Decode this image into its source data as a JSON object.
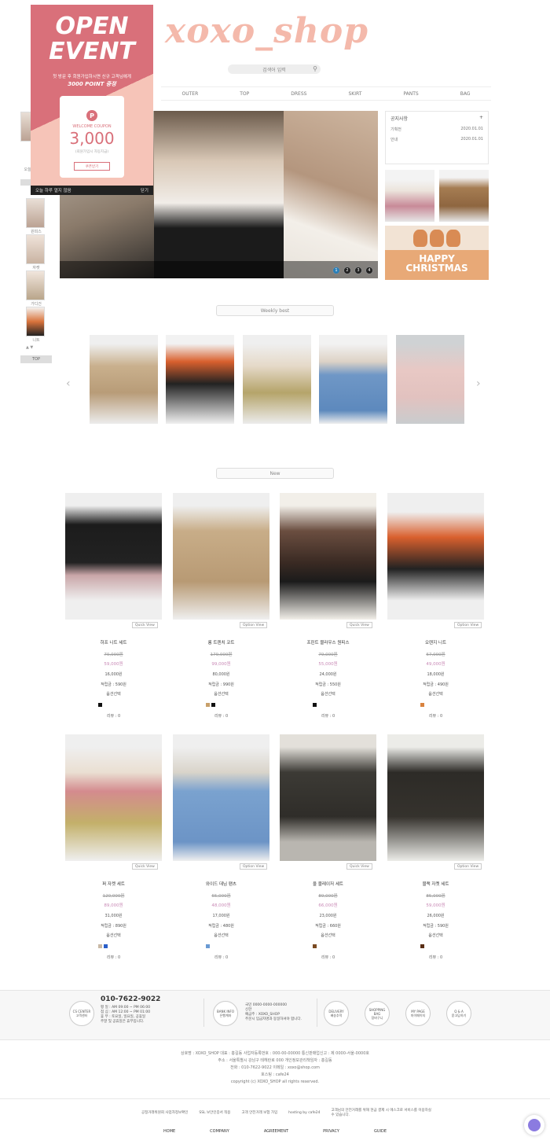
{
  "header": {
    "logo": "xoxo_shop",
    "search_placeholder": "검색어 입력",
    "nav": [
      "OUTER",
      "TOP",
      "DRESS",
      "SKIRT",
      "PANTS",
      "BAG"
    ]
  },
  "popup": {
    "title_line1": "OPEN",
    "title_line2": "EVENT",
    "subtitle": "첫 방문 후 회원가입하시면 신규 고객님에게",
    "subtitle_strong": "3000 POINT 증정",
    "coupon_label": "WELCOME COUPON",
    "coupon_amount": "3,000",
    "coupon_note": "(회원가입시 자동지급)",
    "coupon_button": "쿠폰받기",
    "close_today": "오늘 하루 열지 않음",
    "close": "닫기"
  },
  "sidebar": {
    "title": "오늘본상품",
    "labels": [
      "오늘본상품",
      "원피스",
      "자켓",
      "가디건",
      "니트"
    ],
    "button": "TOP"
  },
  "notice": {
    "title": "공지사항",
    "more": "+",
    "rows": [
      {
        "label": "기획전",
        "date": "2020.01.01"
      },
      {
        "label": "안내",
        "date": "2020.01.01"
      }
    ]
  },
  "banner": {
    "xmas_line1": "HAPPY",
    "xmas_line2": "CHRISTMAS",
    "dots": [
      "1",
      "2",
      "3",
      "4"
    ]
  },
  "sections": {
    "weekly": "Weekly best",
    "new": "New"
  },
  "products": [
    {
      "name": "하프 니트 세트",
      "old": "70,000원",
      "sale": "59,000원",
      "rate": "16,000원",
      "point": "적립금 : 590원",
      "opt": "옵션선택",
      "review": "리뷰 : 0",
      "quick": "Quick View",
      "colors": [
        "#111111"
      ]
    },
    {
      "name": "롱 트렌치 코트",
      "old": "179,000원",
      "sale": "99,000원",
      "rate": "80,000원",
      "point": "적립금 : 990원",
      "opt": "옵션선택",
      "review": "리뷰 : 0",
      "quick": "Option View",
      "colors": [
        "#c8a06a",
        "#111111"
      ]
    },
    {
      "name": "프린트 블라우스 원피스",
      "old": "79,000원",
      "sale": "55,000원",
      "rate": "24,000원",
      "point": "적립금 : 550원",
      "opt": "옵션선택",
      "review": "리뷰 : 0",
      "quick": "Quick View",
      "colors": [
        "#111111"
      ]
    },
    {
      "name": "오렌지 니트",
      "old": "67,000원",
      "sale": "49,000원",
      "rate": "18,000원",
      "point": "적립금 : 490원",
      "opt": "옵션선택",
      "review": "리뷰 : 0",
      "quick": "Option View",
      "colors": [
        "#d9833f"
      ]
    },
    {
      "name": "퍼 자켓 세트",
      "old": "120,000원",
      "sale": "89,000원",
      "rate": "31,000원",
      "point": "적립금 : 890원",
      "opt": "옵션선택",
      "review": "리뷰 : 0",
      "quick": "Quick View",
      "colors": [
        "#c9b9a5",
        "#2b5fc9"
      ]
    },
    {
      "name": "와이드 데님 팬츠",
      "old": "65,000원",
      "sale": "48,000원",
      "rate": "17,000원",
      "point": "적립금 : 480원",
      "opt": "옵션선택",
      "review": "리뷰 : 0",
      "quick": "Option View",
      "colors": [
        "#6a9ad3"
      ]
    },
    {
      "name": "울 블레이저 세트",
      "old": "89,000원",
      "sale": "66,000원",
      "rate": "23,000원",
      "point": "적립금 : 660원",
      "opt": "옵션선택",
      "review": "리뷰 : 0",
      "quick": "Quick View",
      "colors": [
        "#7a4a22"
      ]
    },
    {
      "name": "블랙 자켓 세트",
      "old": "85,000원",
      "sale": "59,000원",
      "rate": "26,000원",
      "point": "적립금 : 590원",
      "opt": "옵션선택",
      "review": "리뷰 : 0",
      "quick": "Option View",
      "colors": [
        "#5a2e16"
      ]
    }
  ],
  "footer": {
    "cs_label": "CS CENTER",
    "cs_sub": "고객센터",
    "phone": "010-7622-9022",
    "hours": [
      "평 일 : AM 09:00 ~ PM 06:00",
      "점 심 : AM 12:00 ~ PM 01:00",
      "휴 무 : 토요일, 일요일, 공휴일"
    ],
    "hours_note": "주말 및 공휴일은 휴무입니다.",
    "bank_label": "BANK INFO",
    "bank_sub": "은행계좌",
    "bank_lines": [
      "국민 0000-0000-000000",
      "신한",
      "예금주 : XOXO_SHOP",
      "주문시 입금자명과 동일하셔야 합니다."
    ],
    "circles": [
      {
        "en": "DELIVERY",
        "ko": "배송추적"
      },
      {
        "en": "SHOPPING BAG",
        "ko": "장바구니"
      },
      {
        "en": "MY PAGE",
        "ko": "마이페이지"
      },
      {
        "en": "Q & A",
        "ko": "묻고답하기"
      }
    ],
    "info_lines": [
      "상호명 : XOXO_SHOP  대표 : 홍길동  사업자등록번호 : 000-00-00000  통신판매업신고 : 제 0000-서울-0000호",
      "주소 : 서울특별시 강남구 테헤란로 000  개인정보관리책임자 : 홍길동",
      "전화 : 010-7622-9022  이메일 : xoxo@shop.com",
      "호스팅 : cafe24",
      "copyright (c) XOXO_SHOP all rights reserved."
    ],
    "badges": [
      "공정거래위원회 사업자정보확인",
      "SSL 보안인증서 적용",
      "고객 안전거래 보험 가입",
      "hosting by cafe24",
      "고객님의 안전거래를 위해 현금 결제 시 에스크로 서비스를 이용하실 수 있습니다."
    ],
    "bottom_links": [
      "HOME",
      "COMPANY",
      "AGREEMENT",
      "PRIVACY",
      "GUIDE"
    ]
  },
  "colors": {
    "logo": "#f4b9ab",
    "popup_pink": "#d9707a",
    "sale": "#c98ab6",
    "active_dot": "#2a7fb8"
  }
}
